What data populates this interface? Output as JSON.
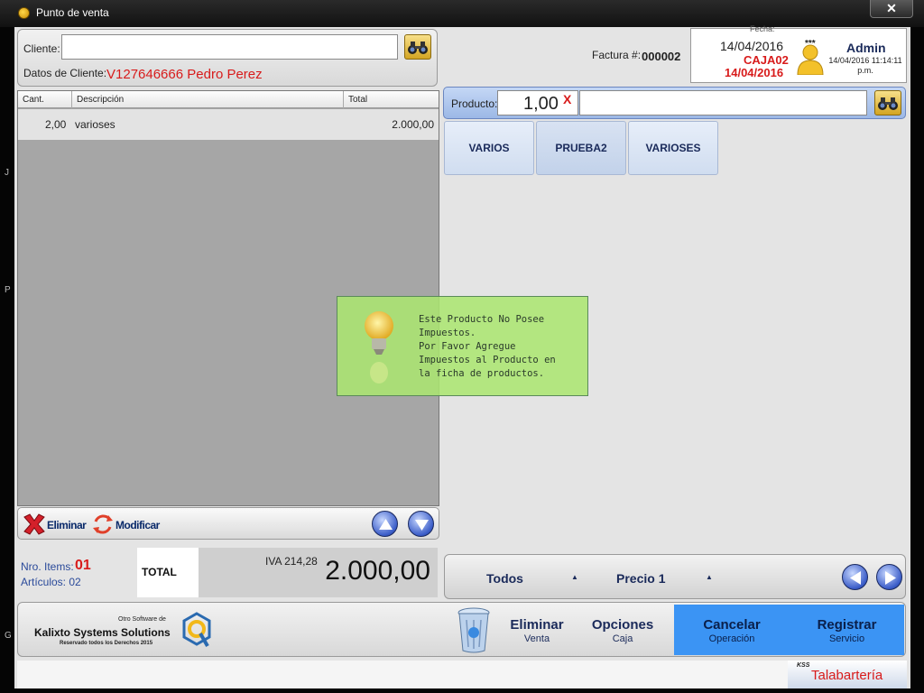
{
  "window": {
    "title": "Punto de venta",
    "close_glyph": "✕"
  },
  "cliente": {
    "label": "Cliente:",
    "value": "",
    "datos_label": "Datos de Cliente:",
    "datos_value": "V127646666  Pedro Perez"
  },
  "grid": {
    "headers": [
      "Cant.",
      "Descripción",
      "Total"
    ],
    "rows": [
      {
        "cant": "2,00",
        "descripcion": "varioses",
        "total": "2.000,00"
      }
    ]
  },
  "edit_bar": {
    "eliminar": "Eliminar",
    "modificar": "Modificar"
  },
  "totals": {
    "nro_items_label": "Nro. Items:",
    "nro_items": "01",
    "articulos": "Artículos: 02",
    "total_label": "TOTAL",
    "iva": "IVA 214,28",
    "amount": "2.000,00"
  },
  "factura": {
    "label": "Factura #:",
    "number": "000002"
  },
  "user": {
    "fecha_label": "Fecha:",
    "date": "14/04/2016",
    "caja": "CAJA02",
    "caja_date": "14/04/2016",
    "stars": "***",
    "name": "Admin",
    "login_time": "14/04/2016 11:14:11 p.m."
  },
  "producto": {
    "label": "Producto:",
    "qty": "1,00",
    "qty_clear": "X",
    "value": ""
  },
  "categories": [
    "VARIOS",
    "PRUEBA2",
    "VARIOSES"
  ],
  "nav": {
    "filter": "Todos",
    "price": "Precio 1",
    "arrow": "▲"
  },
  "bottom": {
    "logo_small": "Otro Software de",
    "logo_main": "Kalixto Systems Solutions",
    "logo_rights": "Reservado todos los Derechos 2015",
    "eliminar": {
      "big": "Eliminar",
      "small": "Venta"
    },
    "opciones": {
      "big": "Opciones",
      "small": "Caja"
    },
    "cancelar": {
      "big": "Cancelar",
      "small": "Operación"
    },
    "registrar": {
      "big": "Registrar",
      "small": "Servicio"
    }
  },
  "status": {
    "kss": "KSS",
    "company": "Talabartería"
  },
  "toast": {
    "message": "Este Producto No Posee\nImpuestos.\nPor Favor Agregue\nImpuestos al Producto en\nla ficha de productos."
  },
  "edge_chars": [
    "J",
    "P",
    "G"
  ],
  "colors": {
    "accent_red": "#d81b1b",
    "action_blue": "#3b94f4",
    "toast_green": "#aae66e"
  }
}
